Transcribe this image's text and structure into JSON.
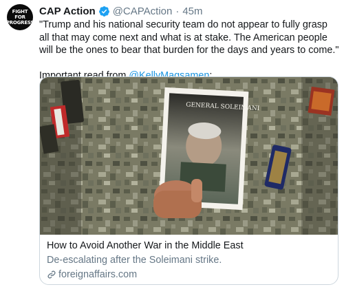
{
  "tweet": {
    "avatar_line1": "FIGHT FOR",
    "avatar_line2": "PROGRESS",
    "display_name": "CAP Action",
    "handle": "@CAPAction",
    "separator": "·",
    "time": "45m",
    "text_main": "\"Trump and his national security team do not appear to fully grasp all that may come next and what is at stake. The American people will be the ones to bear that burden for the days and years to come.\"",
    "text_read_prefix": "Important read from ",
    "mention": "@KellyMagsamen",
    "text_read_suffix": ":",
    "verified_icon": "verified-badge-icon"
  },
  "card": {
    "image_caption": "GENERAL SOLEIMANI",
    "title": "How to Avoid Another War in the Middle East",
    "description": "De-escalating after the Soleimani strike.",
    "domain": "foreignaffairs.com",
    "link_icon": "link-icon"
  },
  "colors": {
    "link_blue": "#1b95e0",
    "secondary_gray": "#657786",
    "primary_text": "#14171a",
    "border": "#ccd6dd"
  }
}
